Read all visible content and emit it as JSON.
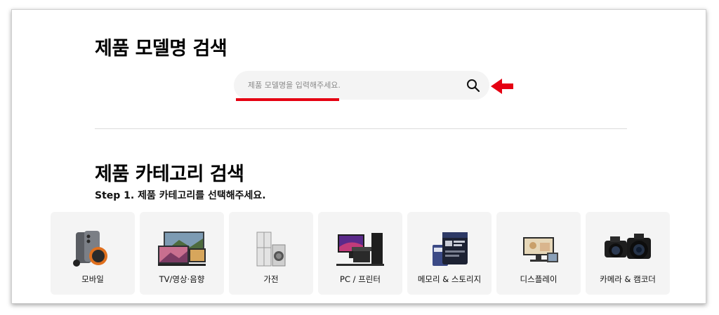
{
  "model_search": {
    "title": "제품 모델명 검색",
    "placeholder": "제품 모델명을 입력해주세요."
  },
  "category_search": {
    "title": "제품 카테고리 검색",
    "step": "Step 1. 제품 카테고리를 선택해주세요."
  },
  "categories": [
    {
      "label": "모바일",
      "icon": "mobile-devices-image"
    },
    {
      "label": "TV/영상·음향",
      "icon": "tv-image"
    },
    {
      "label": "가전",
      "icon": "appliances-image"
    },
    {
      "label": "PC / 프린터",
      "icon": "pc-printer-image"
    },
    {
      "label": "메모리 & 스토리지",
      "icon": "memory-card-image"
    },
    {
      "label": "디스플레이",
      "icon": "monitor-image"
    },
    {
      "label": "카메라 & 캠코더",
      "icon": "camera-image"
    }
  ],
  "colors": {
    "accent": "#e50012",
    "card_bg": "#f4f4f4",
    "search_bg": "#f4f4f4"
  }
}
